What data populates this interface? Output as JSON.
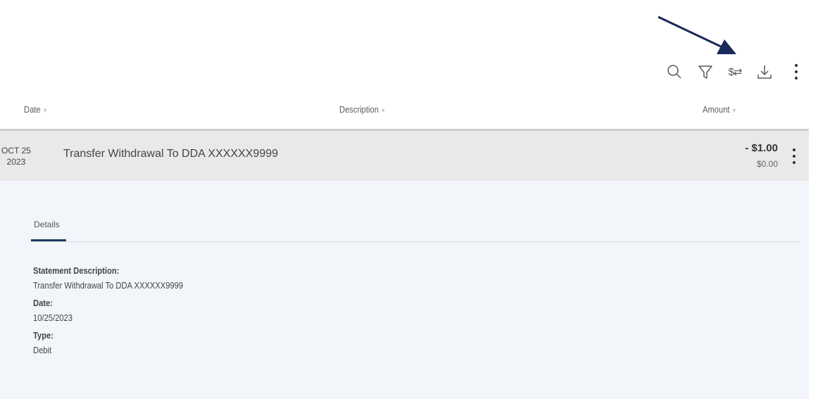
{
  "toolbar": {
    "icons": [
      "search-icon",
      "filter-icon",
      "currency-exchange-icon",
      "download-icon",
      "more-vertical-icon"
    ],
    "currency_glyph": "$⇄"
  },
  "table_header": {
    "date": "Date",
    "description": "Description",
    "amount": "Amount"
  },
  "transaction": {
    "date_month_day": "OCT 25",
    "date_year": "2023",
    "description": "Transfer Withdrawal To DDA XXXXXX9999",
    "amount": "- $1.00",
    "balance": "$0.00"
  },
  "details": {
    "tab_label": "Details",
    "fields": [
      {
        "label": "Statement Description:",
        "value": "Transfer Withdrawal To DDA XXXXXX9999"
      },
      {
        "label": "Date:",
        "value": "10/25/2023"
      },
      {
        "label": "Type:",
        "value": "Debit"
      }
    ]
  },
  "colors": {
    "accent": "#1f3b63",
    "row_bg": "#e9e9e9",
    "details_bg": "#f2f6fa",
    "annotation_arrow": "#1a2a5a"
  }
}
